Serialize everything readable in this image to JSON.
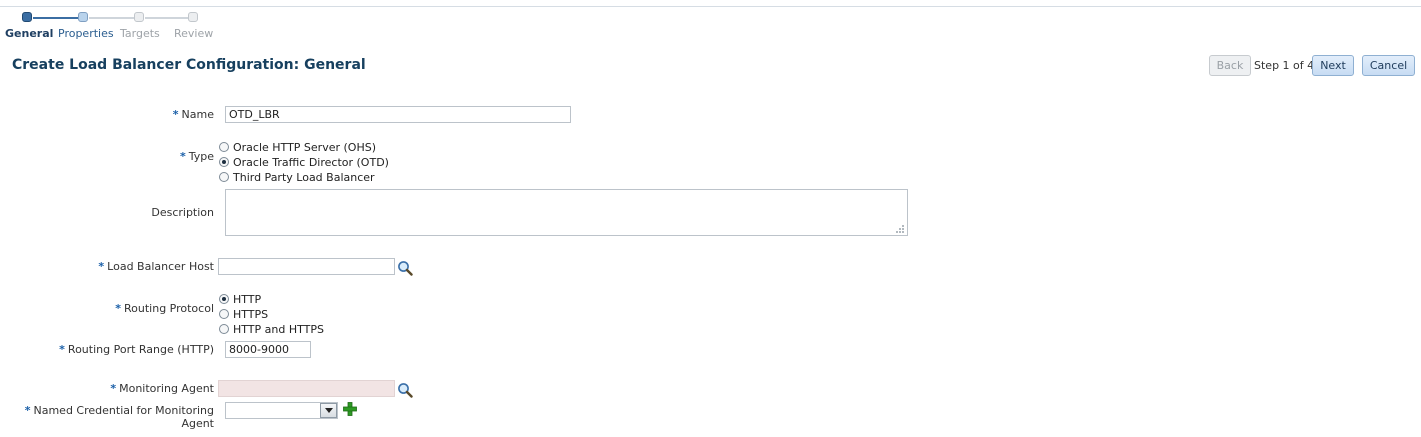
{
  "train": {
    "steps": [
      {
        "label": "General",
        "color": "#1f3f62"
      },
      {
        "label": "Properties",
        "color": "#2a5d8f"
      },
      {
        "label": "Targets",
        "color": "#9ea3a8"
      },
      {
        "label": "Review",
        "color": "#9ea3a8"
      }
    ]
  },
  "header": {
    "title": "Create Load Balancer Configuration: General",
    "back_label": "Back",
    "step_info": "Step 1 of 4",
    "next_label": "Next",
    "cancel_label": "Cancel"
  },
  "form": {
    "required_marker": "*",
    "name": {
      "label": "Name",
      "value": "OTD_LBR"
    },
    "type": {
      "label": "Type",
      "options": [
        "Oracle HTTP Server (OHS)",
        "Oracle Traffic Director (OTD)",
        "Third Party Load Balancer"
      ],
      "selected": "Oracle Traffic Director (OTD)"
    },
    "description": {
      "label": "Description",
      "value": ""
    },
    "load_balancer_host": {
      "label": "Load Balancer Host",
      "value": ""
    },
    "routing_protocol": {
      "label": "Routing Protocol",
      "options": [
        "HTTP",
        "HTTPS",
        "HTTP and HTTPS"
      ],
      "selected": "HTTP"
    },
    "routing_port_range": {
      "label": "Routing Port Range (HTTP)",
      "value": "8000-9000"
    },
    "monitoring_agent": {
      "label": "Monitoring Agent",
      "value": "",
      "disabled_bg": "#f2e4e4"
    },
    "named_credential": {
      "label": "Named Credential for Monitoring Agent",
      "value": ""
    }
  },
  "colors": {
    "accent": "#3b6ea3",
    "title": "#17405f",
    "required": "#1a5fa8",
    "add_icon": "#2e9a24"
  }
}
